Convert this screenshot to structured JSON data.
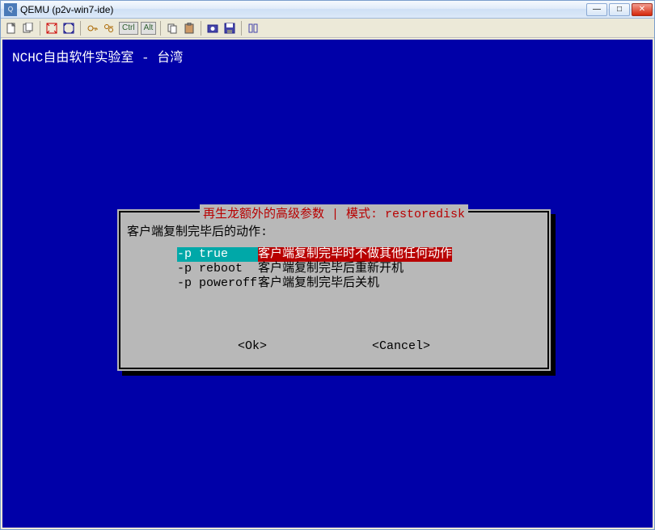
{
  "window": {
    "title": "QEMU (p2v-win7-ide)",
    "minimize": "—",
    "maximize": "□",
    "close": "✕"
  },
  "header_line": "NCHC自由软件实验室 - 台湾",
  "dialog": {
    "title": "再生龙额外的高级参数 | 模式: restoredisk",
    "prompt": "客户端复制完毕后的动作:",
    "options": [
      {
        "flag": "-p true",
        "desc": "客户端复制完毕时不做其他任何动作",
        "selected": true
      },
      {
        "flag": "-p reboot",
        "desc": "客户端复制完毕后重新开机",
        "selected": false
      },
      {
        "flag": "-p poweroff",
        "desc": "客户端复制完毕后关机",
        "selected": false
      }
    ],
    "ok_label": "<Ok>",
    "cancel_label": "<Cancel>"
  },
  "toolbar": {
    "ctrl": "Ctrl",
    "alt": "Alt"
  }
}
